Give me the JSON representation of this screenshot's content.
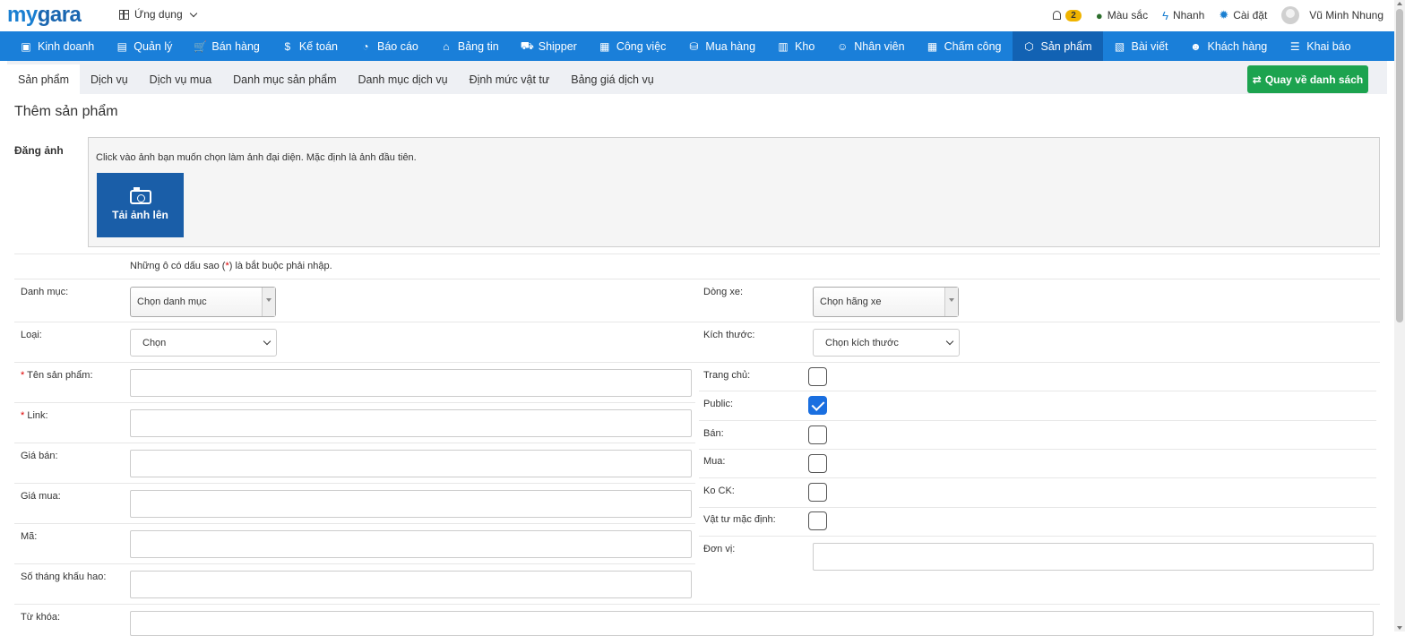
{
  "header": {
    "logo_my": "my",
    "logo_gara": "gara",
    "apps_label": "Ứng dụng",
    "notification_count": "2",
    "color_label": "Màu sắc",
    "quick_label": "Nhanh",
    "settings_label": "Cài đặt",
    "user_name": "Vũ Minh Nhung"
  },
  "nav": [
    {
      "icon": "▣",
      "label": "Kinh doanh"
    },
    {
      "icon": "▤",
      "label": "Quản lý"
    },
    {
      "icon": "🛒",
      "label": "Bán hàng"
    },
    {
      "icon": "$",
      "label": "Kế toán"
    },
    {
      "icon": "◔",
      "label": "Báo cáo"
    },
    {
      "icon": "⌂",
      "label": "Bảng tin"
    },
    {
      "icon": "⛟",
      "label": "Shipper"
    },
    {
      "icon": "▦",
      "label": "Công việc"
    },
    {
      "icon": "⛁",
      "label": "Mua hàng"
    },
    {
      "icon": "▥",
      "label": "Kho"
    },
    {
      "icon": "☺",
      "label": "Nhân viên"
    },
    {
      "icon": "▦",
      "label": "Chấm công"
    },
    {
      "icon": "⬡",
      "label": "Sản phẩm"
    },
    {
      "icon": "▧",
      "label": "Bài viết"
    },
    {
      "icon": "☻",
      "label": "Khách hàng"
    },
    {
      "icon": "☰",
      "label": "Khai báo"
    }
  ],
  "tabs": [
    "Sản phẩm",
    "Dịch vụ",
    "Dịch vụ mua",
    "Danh mục sản phẩm",
    "Danh mục dịch vụ",
    "Định mức vật tư",
    "Bảng giá dịch vụ"
  ],
  "back_button": "Quay về danh sách",
  "page_title": "Thêm sản phẩm",
  "upload": {
    "label": "Đăng ảnh",
    "hint": "Click vào ảnh bạn muốn chọn làm ảnh đại diện. Mặc định là ảnh đầu tiên.",
    "button": "Tải ảnh lên"
  },
  "required_note": {
    "before": "Những ô có dấu sao (",
    "star": "*",
    "after": ") là bắt buộc phải nhập."
  },
  "form": {
    "category_label": "Danh mục:",
    "category_value": "Chọn danh mục",
    "type_label": "Loại:",
    "type_value": "Chọn",
    "name_label": "Tên sản phẩm:",
    "link_label": "Link:",
    "sell_price_label": "Giá bán:",
    "buy_price_label": "Giá mua:",
    "code_label": "Mã:",
    "depreciation_label": "Số tháng khấu hao:",
    "keyword_label": "Từ khóa:",
    "car_line_label": "Dòng xe:",
    "car_line_value": "Chọn hãng xe",
    "size_label": "Kích thước:",
    "size_value": "Chọn kích thước",
    "home_label": "Trang chủ:",
    "public_label": "Public:",
    "sell_label": "Bán:",
    "buy_label": "Mua:",
    "no_ck_label": "Ko CK:",
    "default_material_label": "Vật tư mặc định:",
    "unit_label": "Đơn vị:",
    "star": "*"
  }
}
